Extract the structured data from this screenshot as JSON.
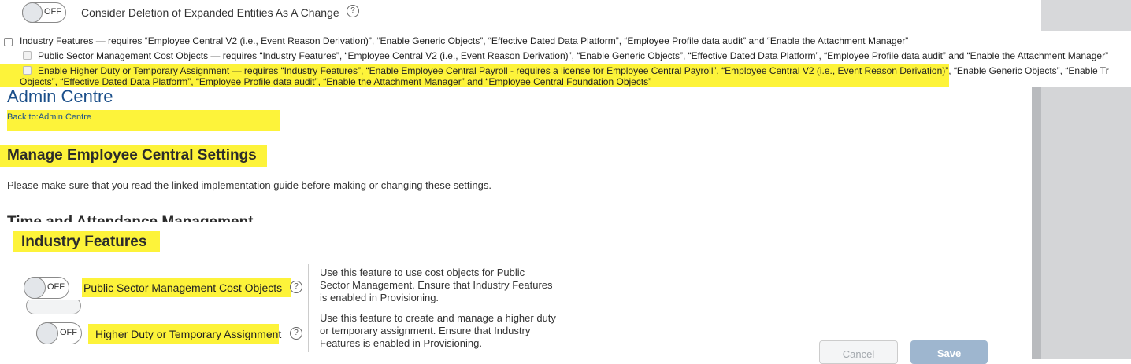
{
  "top_setting": {
    "toggle_state": "OFF",
    "label": "Consider Deletion of Expanded Entities As A Change",
    "help_glyph": "?"
  },
  "requirements": {
    "industry_features": "Industry Features — requires “Employee Central V2 (i.e., Event Reason Derivation)”, “Enable Generic Objects”, “Effective Dated Data Platform”, “Employee Profile data audit” and “Enable the Attachment Manager”",
    "public_sector": "Public Sector Management Cost Objects — requires “Industry Features”, “Employee Central V2 (i.e., Event Reason Derivation)”, “Enable Generic Objects”, “Effective Dated Data Platform”, “Employee Profile data audit” and “Enable the Attachment Manager”",
    "higher_duty_line1": "Enable Higher Duty or Temporary Assignment — requires “Industry Features”, “Enable Employee Central Payroll - requires a license for Employee Central Payroll”, “Employee Central V2 (i.e., Event Reason Derivation)”, “Enable Generic Objects”, “Enable Tr",
    "higher_duty_line2": "Objects”, “Effective Dated Data Platform”, “Employee Profile data audit”, “Enable the Attachment Manager” and “Employee Central Foundation Objects”"
  },
  "admin": {
    "title": "Admin Centre",
    "back_link": "Back to:Admin Centre"
  },
  "main": {
    "heading": "Manage Employee Central Settings",
    "intro": "Please make sure that you read the linked implementation guide before making or changing these settings.",
    "partial_heading": "Time and Attendance Management"
  },
  "industry": {
    "heading": "Industry Features",
    "items": [
      {
        "toggle_state": "OFF",
        "label": "Public Sector Management Cost Objects",
        "help_glyph": "?",
        "description": "Use this feature to use cost objects for Public Sector Management. Ensure that Industry Features is enabled in Provisioning."
      },
      {
        "toggle_state": "OFF",
        "label": "Higher Duty or Temporary Assignment",
        "help_glyph": "?",
        "description": "Use this feature to create and manage a higher duty or temporary assignment. Ensure that Industry Features is enabled in Provisioning."
      }
    ]
  },
  "footer": {
    "cancel_label": "Cancel",
    "save_label": "Save"
  },
  "colors": {
    "highlight": "#fdf33a",
    "title_blue": "#1b4f8a",
    "save_bg": "#9eb6cf"
  }
}
